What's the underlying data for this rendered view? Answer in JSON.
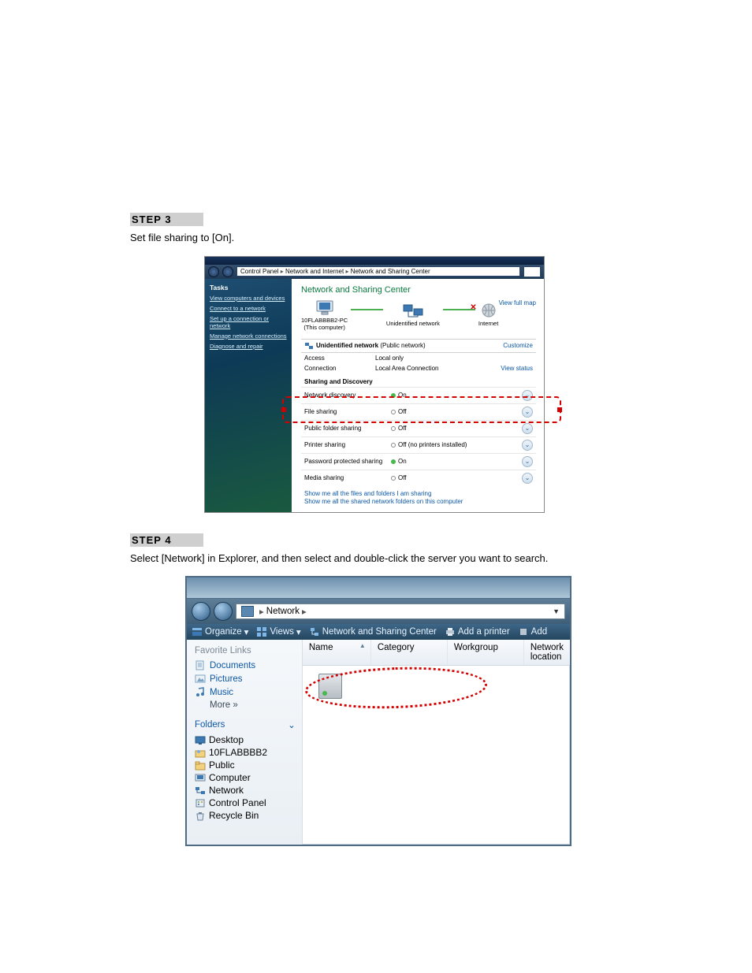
{
  "steps": {
    "step3_label": "STEP 3",
    "step3_text": "Set file sharing to [On].",
    "step4_label": "STEP 4",
    "step4_text": "Select [Network] in Explorer, and then select and double-click the server you want to search."
  },
  "shot1": {
    "breadcrumb": [
      "Control Panel",
      "Network and Internet",
      "Network and Sharing Center"
    ],
    "tasks_header": "Tasks",
    "tasks": [
      "View computers and devices",
      "Connect to a network",
      "Set up a connection or network",
      "Manage network connections",
      "Diagnose and repair"
    ],
    "title": "Network and Sharing Center",
    "view_full_map": "View full map",
    "nodes": {
      "pc": "10FLABBBB2-PC",
      "pc_sub": "(This computer)",
      "mid": "Unidentified network",
      "internet": "Internet"
    },
    "network_section": {
      "name": "Unidentified network",
      "type": "(Public network)",
      "customize": "Customize"
    },
    "kv": [
      {
        "k": "Access",
        "v": "Local only"
      },
      {
        "k": "Connection",
        "v": "Local Area Connection",
        "right": "View status"
      }
    ],
    "sharing_header": "Sharing and Discovery",
    "rows": [
      {
        "label": "Network discovery",
        "val": "On",
        "dot": "g"
      },
      {
        "label": "File sharing",
        "val": "Off",
        "dot": "o"
      },
      {
        "label": "Public folder sharing",
        "val": "Off",
        "dot": "o"
      },
      {
        "label": "Printer sharing",
        "val": "Off (no printers installed)",
        "dot": "o"
      },
      {
        "label": "Password protected sharing",
        "val": "On",
        "dot": "g"
      },
      {
        "label": "Media sharing",
        "val": "Off",
        "dot": "o"
      }
    ],
    "links": [
      "Show me all the files and folders I am sharing",
      "Show me all the shared network folders on this computer"
    ]
  },
  "shot2": {
    "breadcrumb": "Network",
    "toolbar": {
      "organize": "Organize",
      "views": "Views",
      "nsc": "Network and Sharing Center",
      "add_printer": "Add a printer",
      "add": "Add"
    },
    "fav_header": "Favorite Links",
    "favorites": [
      "Documents",
      "Pictures",
      "Music",
      "More  »"
    ],
    "folders_header": "Folders",
    "tree": [
      "Desktop",
      "10FLABBBB2",
      "Public",
      "Computer",
      "Network",
      "Control Panel",
      "Recycle Bin"
    ],
    "columns": [
      "Name",
      "Category",
      "Workgroup",
      "Network location"
    ]
  }
}
